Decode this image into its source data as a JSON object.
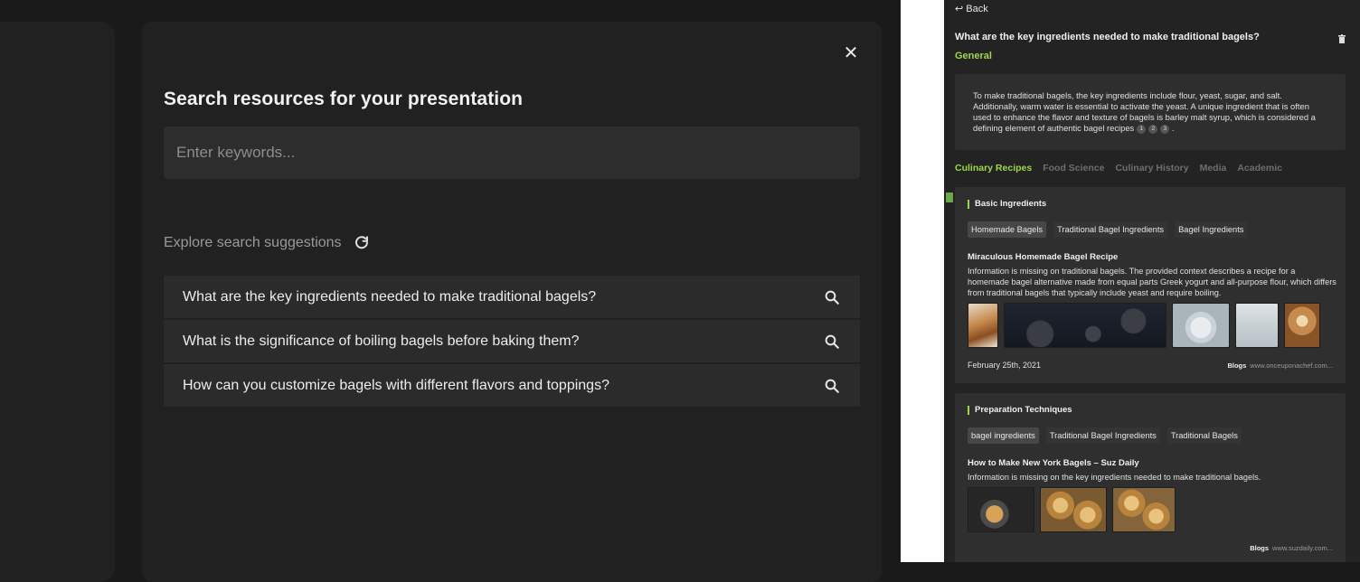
{
  "modal": {
    "title": "Search resources for your presentation",
    "search_placeholder": "Enter keywords...",
    "suggestions_label": "Explore search suggestions",
    "suggestions": [
      "What are the key ingredients needed to make traditional bagels?",
      "What is the significance of boiling bagels before baking them?",
      "How can you customize bagels with different flavors and toppings?"
    ]
  },
  "panel": {
    "back_label": "Back",
    "question": "What are the key ingredients needed to make traditional bagels?",
    "category": "General",
    "answer": "To make traditional bagels, the key ingredients include flour, yeast, sugar, and salt. Additionally, warm water is essential to activate the yeast. A unique ingredient that is often used to enhance the flavor and texture of bagels is barley malt syrup, which is considered a defining element of authentic bagel recipes",
    "citations": [
      "1",
      "2",
      "3"
    ],
    "answer_end": ".",
    "tabs": [
      "Culinary Recipes",
      "Food Science",
      "Culinary History",
      "Media",
      "Academic"
    ],
    "sections": [
      {
        "title": "Basic Ingredients",
        "chips": [
          "Homemade Bagels",
          "Traditional Bagel Ingredients",
          "Bagel Ingredients"
        ],
        "result_title": "Miraculous Homemade Bagel Recipe",
        "result_desc": "Information is missing on traditional bagels. The provided context describes a recipe for a homemade bagel alternative made from equal parts Greek yogurt and all-purpose flour, which differs from traditional bagels that typically include yeast and require boiling.",
        "date": "February 25th, 2021",
        "source_type": "Blogs",
        "source_url": "www.onceuponachef.com..."
      },
      {
        "title": "Preparation Techniques",
        "chips": [
          "bagel ingredients",
          "Traditional Bagel Ingredients",
          "Traditional Bagels"
        ],
        "result_title": "How to Make New York Bagels – Suz Daily",
        "result_desc": "Information is missing on the key ingredients needed to make traditional bagels.",
        "source_type": "Blogs",
        "source_url": "www.suzdaily.com..."
      }
    ]
  },
  "colors": {
    "accent": "#9ad94a",
    "modal_bg": "#212121",
    "app_bg": "#1a1a1a"
  }
}
